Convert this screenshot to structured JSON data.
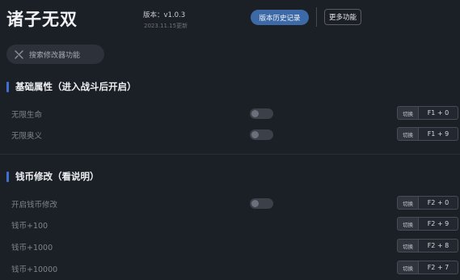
{
  "app": {
    "title": "诸子无双",
    "version": "版本：v1.0.3",
    "updated": "2023.11.15更新"
  },
  "toolbar": {
    "history_label": "版本历史记录",
    "more_label": "更多功能"
  },
  "search": {
    "placeholder": "搜索修改器功能"
  },
  "sections": [
    {
      "title": "基础属性（进入战斗后开启）",
      "rows": [
        {
          "label": "无限生命",
          "has_toggle": true,
          "toggle_on": false,
          "action": "切换",
          "hotkey": "F1 + 0"
        },
        {
          "label": "无限奥义",
          "has_toggle": true,
          "toggle_on": false,
          "action": "切换",
          "hotkey": "F1 + 9"
        }
      ]
    },
    {
      "title": "钱币修改（看说明）",
      "rows": [
        {
          "label": "开启钱币修改",
          "has_toggle": true,
          "toggle_on": false,
          "action": "切换",
          "hotkey": "F2 + 0"
        },
        {
          "label": "钱币+100",
          "has_toggle": false,
          "action": "切换",
          "hotkey": "F2 + 9"
        },
        {
          "label": "钱币+1000",
          "has_toggle": false,
          "action": "切换",
          "hotkey": "F2 + 8"
        },
        {
          "label": "钱币+10000",
          "has_toggle": false,
          "action": "切换",
          "hotkey": "F2 + 7"
        }
      ]
    }
  ],
  "colors": {
    "background": "#1b1f26",
    "accent": "#3f6fd0",
    "history_button": "#3d6aa6"
  },
  "icons": {
    "search": "wrench-icon"
  }
}
